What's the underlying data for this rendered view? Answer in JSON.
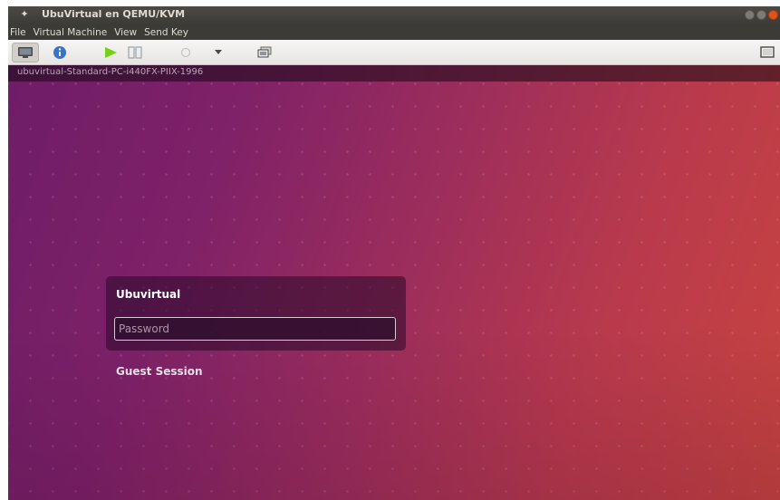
{
  "window": {
    "title": "UbuVirtual en QEMU/KVM"
  },
  "menubar": {
    "items": [
      "File",
      "Virtual Machine",
      "View",
      "Send Key"
    ]
  },
  "toolbar": {
    "buttons": [
      {
        "icon": "monitor-icon"
      },
      {
        "icon": "info-icon"
      },
      {
        "icon": "play-icon"
      },
      {
        "icon": "pause-icon"
      },
      {
        "icon": "power-icon"
      },
      {
        "icon": "dropdown-arrow-icon"
      },
      {
        "icon": "clone-icon"
      },
      {
        "icon": "fullscreen-icon"
      }
    ]
  },
  "vm": {
    "hostname": "ubuvirtual-Standard-PC-i440FX-PIIX-1996",
    "login": {
      "user": "Ubuvirtual",
      "password_placeholder": "Password",
      "guest_session": "Guest Session"
    }
  },
  "colors": {
    "accent": "#e0541c",
    "wallpaper_left": "#6e1d66",
    "wallpaper_right": "#c8443f"
  }
}
